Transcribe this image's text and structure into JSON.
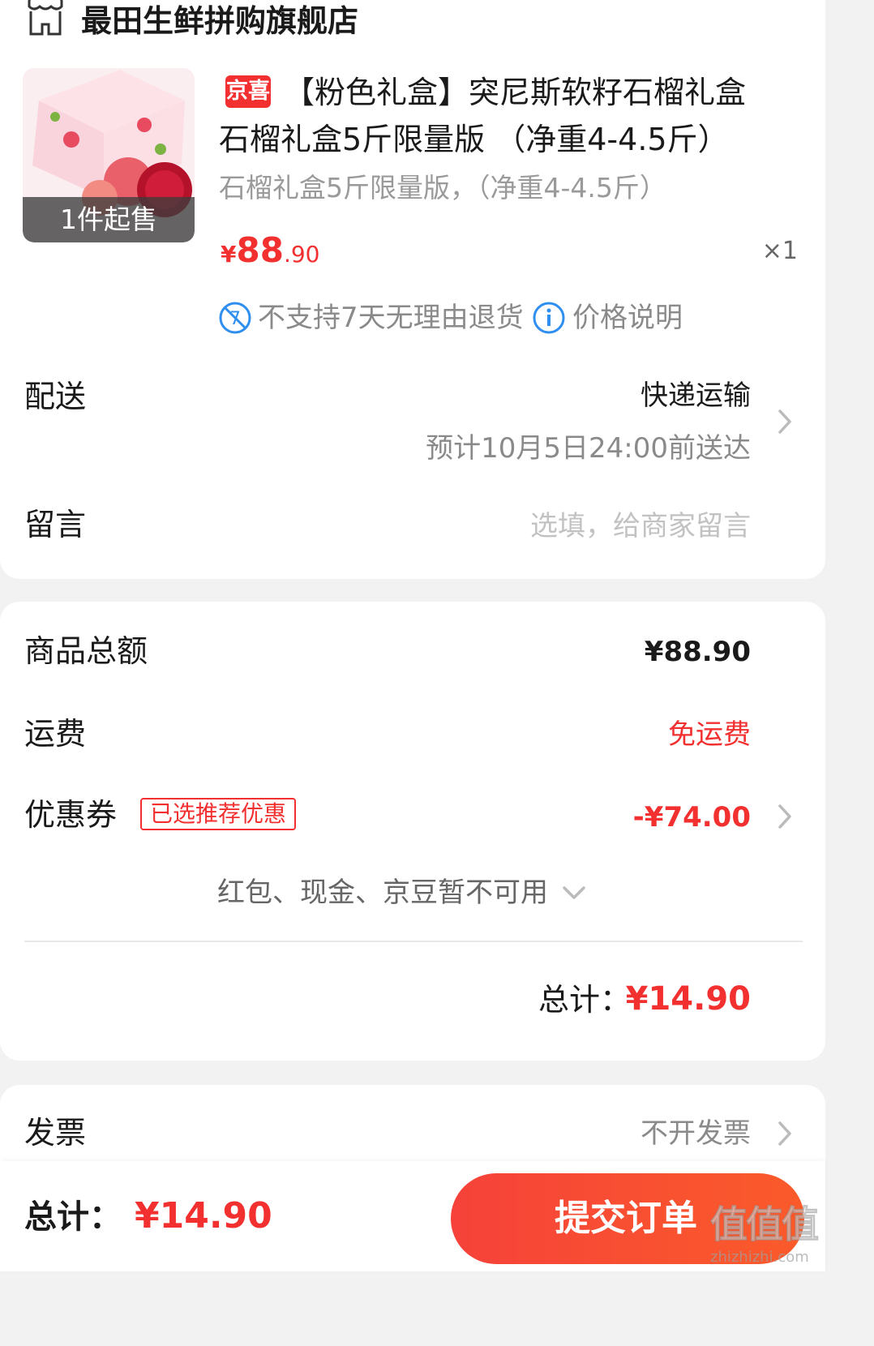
{
  "store": {
    "name": "最田生鲜拼购旗舰店",
    "icon": "store-icon"
  },
  "product": {
    "thumb_badge": "1件起售",
    "tag": "京喜",
    "title_line1": "【粉色礼盒】突尼斯软籽石榴礼盒",
    "title_line2": "石榴礼盒5斤限量版 （净重4-4.5斤）",
    "sku": "石榴礼盒5斤限量版，（净重4-4.5斤）",
    "price_currency": "¥",
    "price_integer": "88",
    "price_decimal": ".90",
    "quantity": "×1",
    "no_return": "不支持7天无理由退货",
    "price_note": "价格说明"
  },
  "delivery": {
    "label": "配送",
    "method": "快递运输",
    "eta": "预计10月5日24:00前送达"
  },
  "message": {
    "label": "留言",
    "placeholder": "选填，给商家留言"
  },
  "amounts": {
    "goods_total_label": "商品总额",
    "goods_total_value": "¥88.90",
    "shipping_label": "运费",
    "shipping_value": "免运费",
    "coupon_label": "优惠券",
    "coupon_tag": "已选推荐优惠",
    "coupon_value": "-¥74.00",
    "unavailable": "红包、现金、京豆暂不可用",
    "total_label": "总计：",
    "total_value": "¥14.90"
  },
  "invoice": {
    "label": "发票",
    "value": "不开发票"
  },
  "bottom": {
    "total_label": "总计：",
    "total_value": "¥14.90",
    "submit_label": "提交订单"
  },
  "watermark": {
    "big": "值值值",
    "small": "zhizhizhi.com"
  },
  "colors": {
    "accent": "#f23030",
    "muted": "#9a9a9a",
    "button_start": "#f6423a",
    "button_end": "#fa5b2a"
  }
}
